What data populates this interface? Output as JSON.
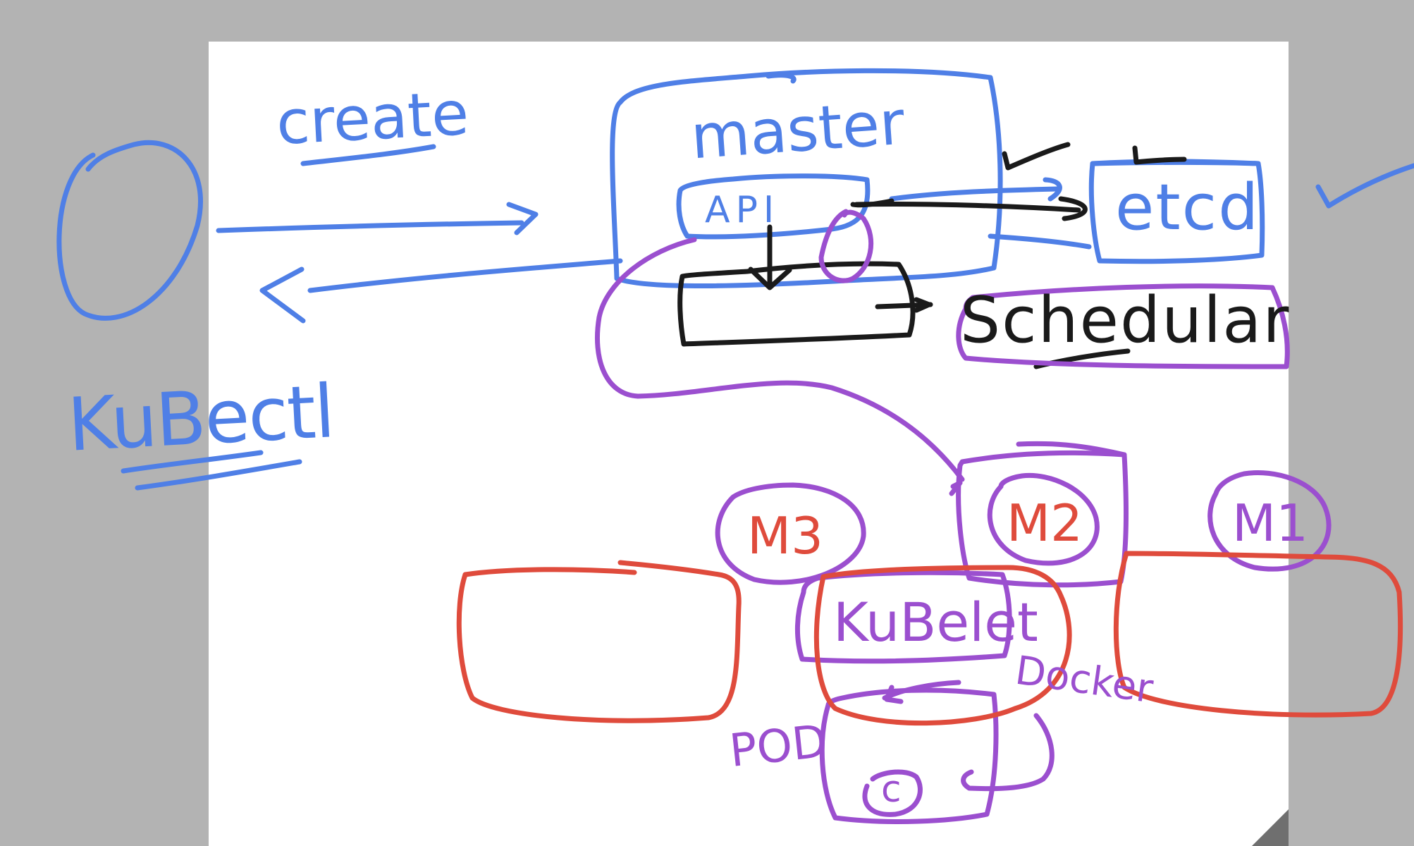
{
  "colors": {
    "background": "#b3b3b3",
    "page": "#ffffff",
    "blue": "#4f7fe6",
    "black": "#1a1a1a",
    "purple": "#9b4fcf",
    "red": "#df4b3c"
  },
  "labels": {
    "create": "create",
    "kubectl": "KuBectl",
    "master": "master",
    "api": "API",
    "etcd": "etcd",
    "scheduler": "Schedular",
    "kubelet": "KuBelet",
    "docker": "Docker",
    "pod": "POD",
    "container": "c",
    "m1": "M1",
    "m2": "M2",
    "m3": "M3"
  }
}
